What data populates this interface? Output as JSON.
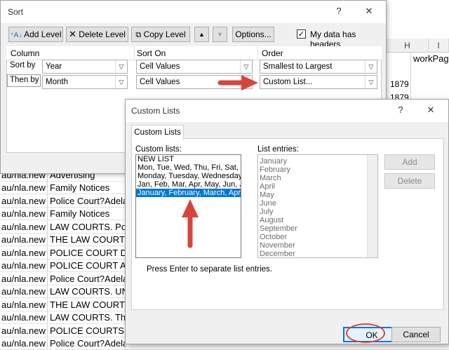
{
  "background_sheet": {
    "columns": [
      {
        "letter": "H"
      },
      {
        "letter": "I"
      }
    ],
    "header_cell": "workPage",
    "years": [
      "1879",
      "1879"
    ],
    "rows": [
      {
        "a": "au/nla.new",
        "b": "Advertising"
      },
      {
        "a": "au/nla.new",
        "b": "Family Notices"
      },
      {
        "a": "au/nla.new",
        "b": "Police Court?Adela"
      },
      {
        "a": "au/nla.new",
        "b": "Family Notices"
      },
      {
        "a": "au/nla.new",
        "b": "LAW COURTS. Polic"
      },
      {
        "a": "au/nla.new",
        "b": "THE LAW COURTS."
      },
      {
        "a": "au/nla.new",
        "b": "POLICE COURT DELA"
      },
      {
        "a": "au/nla.new",
        "b": "POLICE COURT ADE"
      },
      {
        "a": "au/nla.new",
        "b": "Police Court?Adela"
      },
      {
        "a": "au/nla.new",
        "b": "LAW COURTS. UNLA"
      },
      {
        "a": "au/nla.new",
        "b": "THE LAW COURTS."
      },
      {
        "a": "au/nla.new",
        "b": "LAW COURTS. ThE C"
      },
      {
        "a": "au/nla.new",
        "b": "POLICE COURTS AD"
      },
      {
        "a": "au/nla.new",
        "b": "Police Court?Adela"
      }
    ]
  },
  "sort_dialog": {
    "title": "Sort",
    "help": "?",
    "close": "✕",
    "toolbar": {
      "add_level": "Add Level",
      "delete_level": "Delete Level",
      "copy_level": "Copy Level",
      "options": "Options...",
      "headers_checkbox_label": "My data has headers",
      "headers_checked": true
    },
    "grid_headers": {
      "column": "Column",
      "sort_on": "Sort On",
      "order": "Order"
    },
    "levels": [
      {
        "label": "Sort by",
        "column": "Year",
        "sort_on": "Cell Values",
        "order": "Smallest to Largest"
      },
      {
        "label": "Then by",
        "column": "Month",
        "sort_on": "Cell Values",
        "order": "Custom List..."
      }
    ]
  },
  "custom_lists_dialog": {
    "title": "Custom Lists",
    "help": "?",
    "close": "✕",
    "tab": "Custom Lists",
    "custom_lists_label": "Custom lists:",
    "lists": [
      "NEW LIST",
      "Mon, Tue, Wed, Thu, Fri, Sat, S",
      "Monday, Tuesday, Wednesday",
      "Jan, Feb, Mar, Apr, May, Jun, Ju",
      "January, February, March, April"
    ],
    "selected_index": 4,
    "entries_label": "List entries:",
    "entries": [
      "January",
      "February",
      "March",
      "April",
      "May",
      "June",
      "July",
      "August",
      "September",
      "October",
      "November",
      "December"
    ],
    "add_button": "Add",
    "delete_button": "Delete",
    "hint": "Press Enter to separate list entries.",
    "ok_button": "OK",
    "cancel_button": "Cancel"
  },
  "colors": {
    "annotation_red": "#d9443a",
    "selection_blue": "#0078d7"
  }
}
